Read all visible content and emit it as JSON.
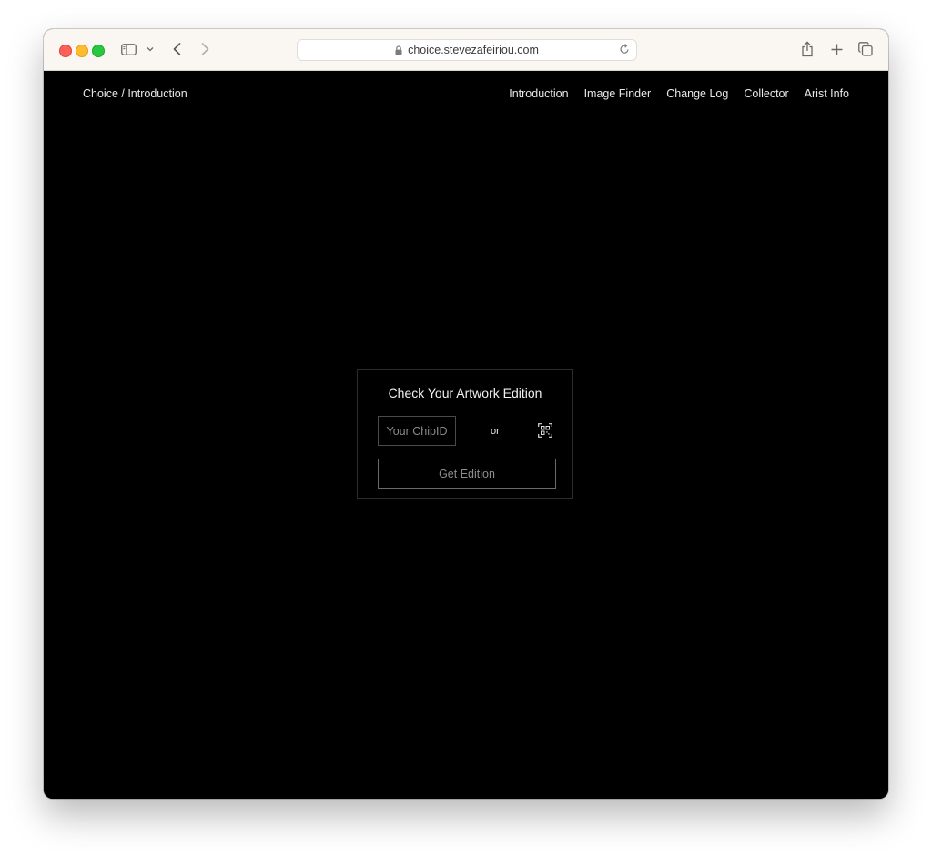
{
  "browser": {
    "url": "choice.stevezafeiriou.com",
    "icons": [
      "sidebar-icon",
      "chevron-down-icon",
      "back-icon",
      "forward-icon",
      "lock-icon",
      "reload-icon",
      "share-icon",
      "new-tab-icon",
      "tabs-overview-icon"
    ]
  },
  "site": {
    "title": "Choice / Introduction",
    "nav": [
      {
        "label": "Introduction"
      },
      {
        "label": "Image Finder"
      },
      {
        "label": "Change Log"
      },
      {
        "label": "Collector"
      },
      {
        "label": "Arist Info"
      }
    ]
  },
  "card": {
    "title": "Check Your Artwork Edition",
    "chip_placeholder": "Your ChipID",
    "or_label": "or",
    "qr_icon": "qr-scan-icon",
    "submit_label": "Get Edition"
  },
  "colors": {
    "page_background": "#000000",
    "toolbar_background": "#faf6f2",
    "text": "#e8e8e8",
    "button_text": "#8d8d8d"
  }
}
